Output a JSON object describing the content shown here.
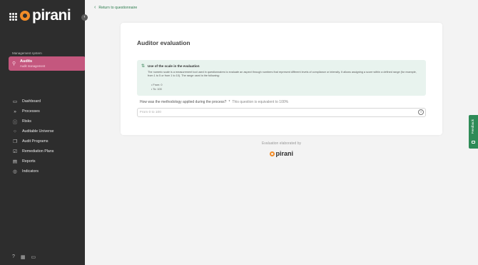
{
  "app": {
    "logo_text": "pirani",
    "brand_color": "#f28c28",
    "accent_color": "#c4577e"
  },
  "sidebar": {
    "management_label": "Management system",
    "module": {
      "title": "Audits",
      "subtitle": "Audit management"
    },
    "nav": [
      {
        "label": "Dashboard",
        "icon": "monitor-icon"
      },
      {
        "label": "Processes",
        "icon": "chevrons-icon"
      },
      {
        "label": "Risks",
        "icon": "warning-icon"
      },
      {
        "label": "Auditable Universe",
        "icon": "nodes-icon"
      },
      {
        "label": "Audit Programs",
        "icon": "programs-icon"
      },
      {
        "label": "Remediation Plans",
        "icon": "checkbox-icon"
      },
      {
        "label": "Reports",
        "icon": "reports-icon"
      },
      {
        "label": "Indicators",
        "icon": "gauge-icon"
      }
    ]
  },
  "main": {
    "back_link": "Return to questionnaire",
    "card": {
      "title": "Auditor evaluation",
      "info": {
        "title": "Use of the scale in the evaluation",
        "description": "The numeric scale is a measurement tool used in questionnaires to evaluate an aspect through numbers that represent different levels of compliance or intensity. It allows assigning a score within a defined range (for example, from 1 to 5 or from 1 to 10). The range used is the following:",
        "range_from": "From: 0",
        "range_to": "To: 100"
      },
      "question": {
        "text": "How was the methodology applied during the process?",
        "required_mark": "*",
        "note": "This question is equivalent to 100%",
        "placeholder": "From 0 to 100"
      }
    },
    "footer": {
      "label": "Evaluation elaborated by",
      "logo_text": "pirani"
    },
    "feedback_label": "Feedback"
  }
}
